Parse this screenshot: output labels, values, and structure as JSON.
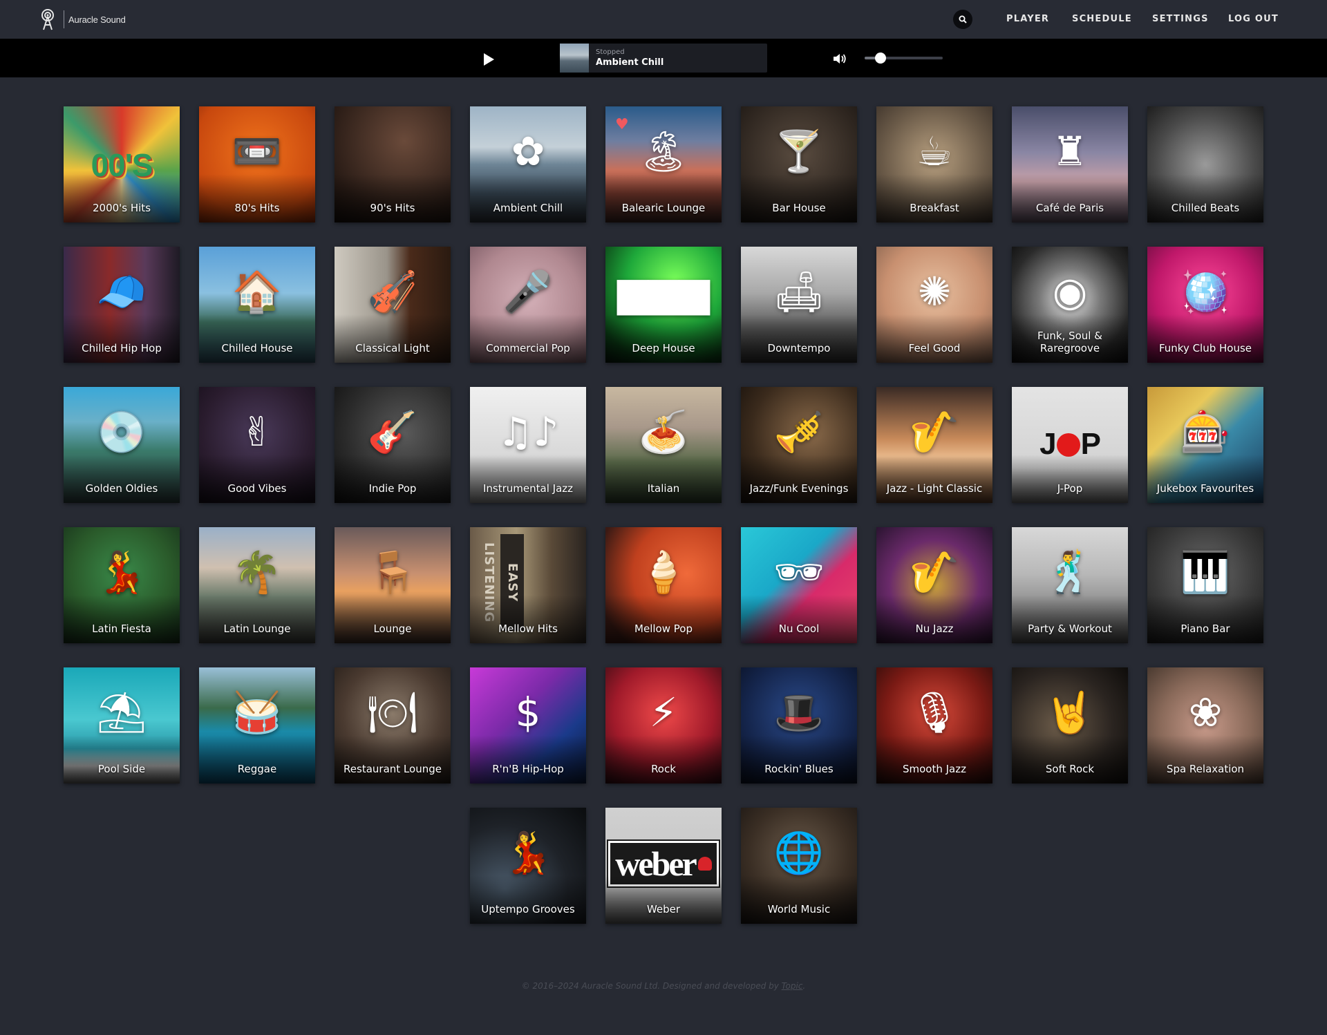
{
  "brand": {
    "name": "Auracle Sound"
  },
  "nav": {
    "items": [
      {
        "label": "PLAYER"
      },
      {
        "label": "SCHEDULE"
      },
      {
        "label": "SETTINGS"
      },
      {
        "label": "LOG OUT"
      }
    ]
  },
  "player": {
    "status": "Stopped",
    "track": "Ambient Chill",
    "volume": 0.2
  },
  "channels": [
    {
      "label": "2000's Hits",
      "icon": "00s-text-icon",
      "glyph": "00'S",
      "bg": "conic-gradient(from 0deg at 50% 55%, #d83a2a, #f0c23a, #5aa34a, #2f8ec9, #d8c38a, #c0452e, #f0c23a, #3c9a6a, #d83a2a)",
      "favorite": false
    },
    {
      "label": "80's Hits",
      "icon": "cassette-icon",
      "glyph": "📼",
      "bg": "radial-gradient(circle at 50% 40%, #f0731c, #c8480e 70%, #8a2a08)",
      "favorite": false
    },
    {
      "label": "90's Hits",
      "icon": "sunglasses-person-icon",
      "glyph": "",
      "bg": "radial-gradient(circle at 60% 30%, #6a4a3a, #2a1c16 70%, #140d0a)",
      "favorite": false
    },
    {
      "label": "Ambient Chill",
      "icon": "dandelion-icon",
      "glyph": "✿",
      "bg": "linear-gradient(#9eb4c6 0%, #c4d0d8 35%, #6e8596 50%, #3a4a58 75%, #2a2f36 100%)",
      "favorite": false
    },
    {
      "label": "Balearic Lounge",
      "icon": "palm-island-icon",
      "glyph": "🏝",
      "bg": "linear-gradient(#2a5b8a 0%, #6f7ea0 30%, #c9705a 55%, #7a3a2e 75%, #3a2420 100%)",
      "favorite": true
    },
    {
      "label": "Bar House",
      "icon": "cocktail-shaker-icon",
      "glyph": "🍸",
      "bg": "radial-gradient(circle at 50% 40%, #5a4c40, #2c241e 70%, #171310)",
      "favorite": false
    },
    {
      "label": "Breakfast",
      "icon": "coffee-pot-icon",
      "glyph": "☕",
      "bg": "radial-gradient(circle at 50% 45%, #b8a080, #6a5a48 60%, #3a3028)",
      "favorite": false
    },
    {
      "label": "Café de Paris",
      "icon": "eiffel-tower-icon",
      "glyph": "♜",
      "bg": "linear-gradient(#4a4e6a 0%, #8a86a4 40%, #c6a0a8 65%, #5a4e5e 100%)",
      "favorite": false
    },
    {
      "label": "Chilled Beats",
      "icon": "speakers-icon",
      "glyph": "",
      "bg": "radial-gradient(circle at 50% 50%, #9a9a9a, #4a4a4a 60%, #1e1e1e)",
      "favorite": false
    },
    {
      "label": "Chilled Hip Hop",
      "icon": "cap-icon",
      "glyph": "🧢",
      "bg": "linear-gradient(90deg, #3a2a4a 0%, #8a2a2a 40%, #5a3a5a 70%, #1e1a24 100%)",
      "favorite": false
    },
    {
      "label": "Chilled House",
      "icon": "house-snowflake-icon",
      "glyph": "🏠",
      "bg": "linear-gradient(#5aa0d8 0%, #8ac0e0 40%, #3a6a5a 65%, #2a4a5a 100%)",
      "favorite": false
    },
    {
      "label": "Classical Light",
      "icon": "violin-icon",
      "glyph": "🎻",
      "bg": "linear-gradient(90deg, #cfcac0 0%, #9a948a 45%, #4a2a1a 65%, #2a1a10 100%)",
      "favorite": false
    },
    {
      "label": "Commercial Pop",
      "icon": "microphone-stars-icon",
      "glyph": "🎤",
      "bg": "radial-gradient(circle at 50% 45%, #d4b0b8, #b08890 60%, #7a5a64)",
      "favorite": false
    },
    {
      "label": "Deep House",
      "icon": "equalizer-icon",
      "glyph": "▆▆▆",
      "bg": "radial-gradient(circle at 60% 30%, #7aff5a, #1ea83a 45%, #0a3a14 80%, #05140a)",
      "favorite": false
    },
    {
      "label": "Downtempo",
      "icon": "sofa-icon",
      "glyph": "🛋",
      "bg": "linear-gradient(#d8d8d8 0%, #a8a8a8 40%, #5a5a5a 70%, #2a2a2a 100%)",
      "favorite": false
    },
    {
      "label": "Feel Good",
      "icon": "dancer-sun-icon",
      "glyph": "✺",
      "bg": "radial-gradient(circle at 50% 40%, #e8c0a0, #c89070 55%, #7a5a48)",
      "favorite": false
    },
    {
      "label": "Funk, Soul & Raregroove",
      "icon": "afro-sunglasses-icon",
      "glyph": "◉",
      "bg": "radial-gradient(circle at 50% 45%, #e8e8e8, #7a7a7a 35%, #2a2a2a 70%, #0a0a0a)",
      "favorite": false
    },
    {
      "label": "Funky Club House",
      "icon": "disco-ball-icon",
      "glyph": "🪩",
      "bg": "radial-gradient(circle at 50% 40%, #ff4a9a, #c0186a 55%, #5a0a36)",
      "favorite": false
    },
    {
      "label": "Golden Oldies",
      "icon": "vinyl-flower-icon",
      "glyph": "💿",
      "bg": "linear-gradient(#3aa8d8 0%, #6ab0c8 30%, #3a7a6a 55%, #2a3a3a 100%)",
      "favorite": false
    },
    {
      "label": "Good Vibes",
      "icon": "peace-hand-icon",
      "glyph": "✌",
      "bg": "radial-gradient(circle at 50% 40%, #4a3a5a, #2a1c2e 60%, #140d18)",
      "favorite": false
    },
    {
      "label": "Indie Pop",
      "icon": "electric-guitar-icon",
      "glyph": "🎸",
      "bg": "radial-gradient(circle at 60% 40%, #5a5a5a, #2a2a2a 60%, #0e0e0e)",
      "favorite": false
    },
    {
      "label": "Instrumental Jazz",
      "icon": "music-notes-icon",
      "glyph": "♫♪",
      "bg": "linear-gradient(#f0f0f0 0%, #d8d8d8 60%, #8a8a8a 100%)",
      "favorite": false
    },
    {
      "label": "Italian",
      "icon": "pasta-bowl-icon",
      "glyph": "🍝",
      "bg": "linear-gradient(#c8b8a0 0%, #a8988a 35%, #5a6a4a 65%, #2a3a28 100%)",
      "favorite": false
    },
    {
      "label": "Jazz/Funk Evenings",
      "icon": "trumpet-icon",
      "glyph": "🎺",
      "bg": "radial-gradient(circle at 60% 40%, #8a6a4a, #3a2a1c 60%, #140e0a)",
      "favorite": false
    },
    {
      "label": "Jazz - Light Classic",
      "icon": "saxophone-icon",
      "glyph": "🎷",
      "bg": "linear-gradient(#3a2a24 0%, #c88a5a 45%, #e8b88a 60%, #5a3a24 100%)",
      "favorite": false
    },
    {
      "label": "J-Pop",
      "icon": "jpop-text-icon",
      "glyph": "JPOP",
      "bg": "linear-gradient(#e4e4e4 0%, #d2d2d2 70%, #6a6a6a 100%)",
      "favorite": false
    },
    {
      "label": "Jukebox Favourites",
      "icon": "jukebox-icon",
      "glyph": "🎰",
      "bg": "linear-gradient(135deg, #c89a3a 0%, #e8c85a 30%, #3a8aa8 55%, #1a3a5a 100%)",
      "favorite": false
    },
    {
      "label": "Latin Fiesta",
      "icon": "latin-dancers-icon",
      "glyph": "💃",
      "bg": "radial-gradient(circle at 50% 40%, #3a8a4a, #2a5a2a 55%, #142a18)",
      "favorite": false
    },
    {
      "label": "Latin Lounge",
      "icon": "guitar-palm-icon",
      "glyph": "🌴",
      "bg": "linear-gradient(#9ab0c8 0%, #d0c0b0 35%, #6a7a6a 60%, #3a3a38 100%)",
      "favorite": false
    },
    {
      "label": "Lounge",
      "icon": "armchair-icon",
      "glyph": "🪑",
      "bg": "linear-gradient(#6a5a5a 0%, #c89070 40%, #e8a060 55%, #3a2a24 100%)",
      "favorite": false
    },
    {
      "label": "Mellow Hits",
      "icon": "easy-listening-icon",
      "glyph": "",
      "bg": "linear-gradient(90deg, #6a5a48 0%, #a89878 40%, #5a4a38 70%, #2a2420 100%)",
      "favorite": false
    },
    {
      "label": "Mellow Pop",
      "icon": "ice-lolly-icon",
      "glyph": "🍦",
      "bg": "radial-gradient(circle at 70% 40%, #f06a3a, #c0401e 50%, #3a1a14 85%)",
      "favorite": false
    },
    {
      "label": "Nu Cool",
      "icon": "cool-sunglasses-icon",
      "glyph": "🕶",
      "bg": "linear-gradient(135deg, #2ac8d8 0%, #1aa8c8 40%, #d82a6a 60%, #e8486a 100%)",
      "favorite": false
    },
    {
      "label": "Nu Jazz",
      "icon": "saxophone-icon",
      "glyph": "🎷",
      "bg": "radial-gradient(circle at 50% 50%, #c8a03a, #6a2a6a 55%, #2a1430)",
      "favorite": false
    },
    {
      "label": "Party & Workout",
      "icon": "dancing-friends-icon",
      "glyph": "🕺",
      "bg": "linear-gradient(#d8d8d8 0%, #b8b8b8 40%, #8a8a8a 70%, #4a4a4a 100%)",
      "favorite": false
    },
    {
      "label": "Piano Bar",
      "icon": "grand-piano-icon",
      "glyph": "🎹",
      "bg": "radial-gradient(circle at 50% 40%, #6a6a6a, #3a3a3a 55%, #181818)",
      "favorite": false
    },
    {
      "label": "Pool Side",
      "icon": "umbrella-lounger-icon",
      "glyph": "⛱",
      "bg": "linear-gradient(#1aa8b8 0%, #4ac8d0 45%, #2a98a8 70%, #d0d0d0 85%, #5a5a5a 100%)",
      "favorite": false
    },
    {
      "label": "Reggae",
      "icon": "bongo-drums-icon",
      "glyph": "🥁",
      "bg": "linear-gradient(#9ac0d8 0%, #3a6a4a 35%, #1a8aa8 55%, #0a4a6a 100%)",
      "favorite": false
    },
    {
      "label": "Restaurant Lounge",
      "icon": "cloche-hand-icon",
      "glyph": "🍽",
      "bg": "radial-gradient(circle at 50% 40%, #8a7a6a, #4a3a30 55%, #1e1814)",
      "favorite": false
    },
    {
      "label": "R'n'B Hip-Hop",
      "icon": "dollar-microphone-icon",
      "glyph": "$",
      "bg": "linear-gradient(135deg, #c83ad8 0%, #7a2aa8 40%, #1a3a8a 70%, #0a1a3a 100%)",
      "favorite": false
    },
    {
      "label": "Rock",
      "icon": "guitar-pick-icon",
      "glyph": "⚡",
      "bg": "radial-gradient(circle at 50% 40%, #f04a4a, #a01a2a 55%, #2a0a10)",
      "favorite": false
    },
    {
      "label": "Rockin' Blues",
      "icon": "fedora-icon",
      "glyph": "🎩",
      "bg": "radial-gradient(circle at 50% 40%, #2a4a8a, #14244a 60%, #080e1e)",
      "favorite": false
    },
    {
      "label": "Smooth Jazz",
      "icon": "retro-microphone-icon",
      "glyph": "🎙",
      "bg": "radial-gradient(circle at 50% 40%, #d84a3a, #7a1a14 55%, #1e0a08)",
      "favorite": false
    },
    {
      "label": "Soft Rock",
      "icon": "rock-hand-icon",
      "glyph": "🤘",
      "bg": "radial-gradient(circle at 40% 50%, #6a5a48, #2a2420 60%, #0e0c0a)",
      "favorite": false
    },
    {
      "label": "Spa Relaxation",
      "icon": "lotus-icon",
      "glyph": "❀",
      "bg": "radial-gradient(circle at 50% 50%, #c89a8a, #8a6a5a 55%, #4a3a30)",
      "favorite": false
    },
    {
      "label": "Uptempo Grooves",
      "icon": "turntable-dancer-icon",
      "glyph": "💃",
      "bg": "radial-gradient(circle at 30% 70%, #4a5a6a, #1e2228 55%, #0a0c0e)",
      "favorite": false
    },
    {
      "label": "Weber",
      "icon": "weber-logo-icon",
      "glyph": "weber",
      "bg": "linear-gradient(#d0d0d0 0%, #c4c4c4 65%, #5a5a5a 100%)",
      "favorite": false
    },
    {
      "label": "World Music",
      "icon": "globe-guitar-icon",
      "glyph": "🌐",
      "bg": "radial-gradient(circle at 50% 40%, #6a5a4a, #3a2e24 55%, #161210)",
      "favorite": false
    }
  ],
  "footer": {
    "text": "© 2016–2024 Auracle Sound Ltd. Designed and developed by ",
    "link": "Topic"
  }
}
